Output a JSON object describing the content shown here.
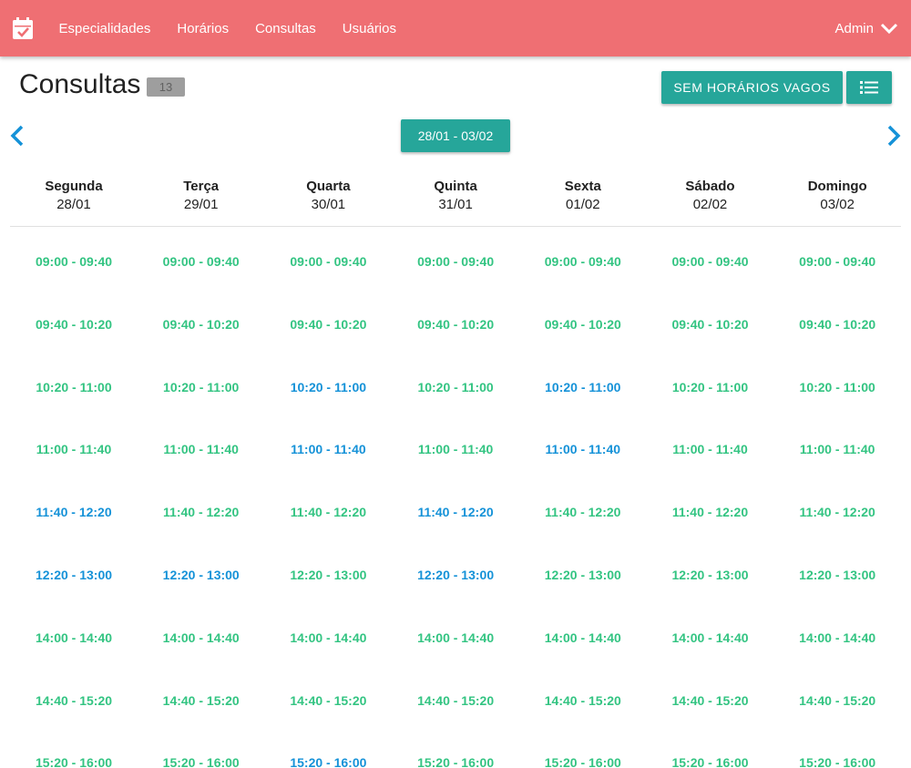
{
  "nav": {
    "brand_icon": "calendar-check-icon",
    "links": [
      "Especialidades",
      "Horários",
      "Consultas",
      "Usuários"
    ],
    "user": "Admin",
    "bg_color": "#ef6f73"
  },
  "page": {
    "title": "Consultas",
    "count": "13",
    "no_slots_button": "SEM HORÁRIOS VAGOS",
    "list_button_icon": "list-icon",
    "week_range": "28/01 - 03/02",
    "prev_icon": "chevron-left-icon",
    "next_icon": "chevron-right-icon"
  },
  "colors": {
    "teal": "#26a69a",
    "free": "#33c482",
    "busy": "#1592d8"
  },
  "days": [
    {
      "name": "Segunda",
      "date": "28/01"
    },
    {
      "name": "Terça",
      "date": "29/01"
    },
    {
      "name": "Quarta",
      "date": "30/01"
    },
    {
      "name": "Quinta",
      "date": "31/01"
    },
    {
      "name": "Sexta",
      "date": "01/02"
    },
    {
      "name": "Sábado",
      "date": "02/02"
    },
    {
      "name": "Domingo",
      "date": "03/02"
    }
  ],
  "time_slots": [
    "09:00 - 09:40",
    "09:40 - 10:20",
    "10:20 - 11:00",
    "11:00 - 11:40",
    "11:40 - 12:20",
    "12:20 - 13:00",
    "14:00 - 14:40",
    "14:40 - 15:20",
    "15:20 - 16:00"
  ],
  "booked": [
    [
      false,
      false,
      false,
      false,
      false,
      false,
      false
    ],
    [
      false,
      false,
      false,
      false,
      false,
      false,
      false
    ],
    [
      false,
      false,
      true,
      false,
      true,
      false,
      false
    ],
    [
      false,
      false,
      true,
      false,
      true,
      false,
      false
    ],
    [
      true,
      false,
      false,
      true,
      false,
      false,
      false
    ],
    [
      true,
      true,
      false,
      true,
      false,
      false,
      false
    ],
    [
      false,
      false,
      false,
      false,
      false,
      false,
      false
    ],
    [
      false,
      false,
      false,
      false,
      false,
      false,
      false
    ],
    [
      false,
      false,
      true,
      false,
      false,
      false,
      false
    ]
  ]
}
